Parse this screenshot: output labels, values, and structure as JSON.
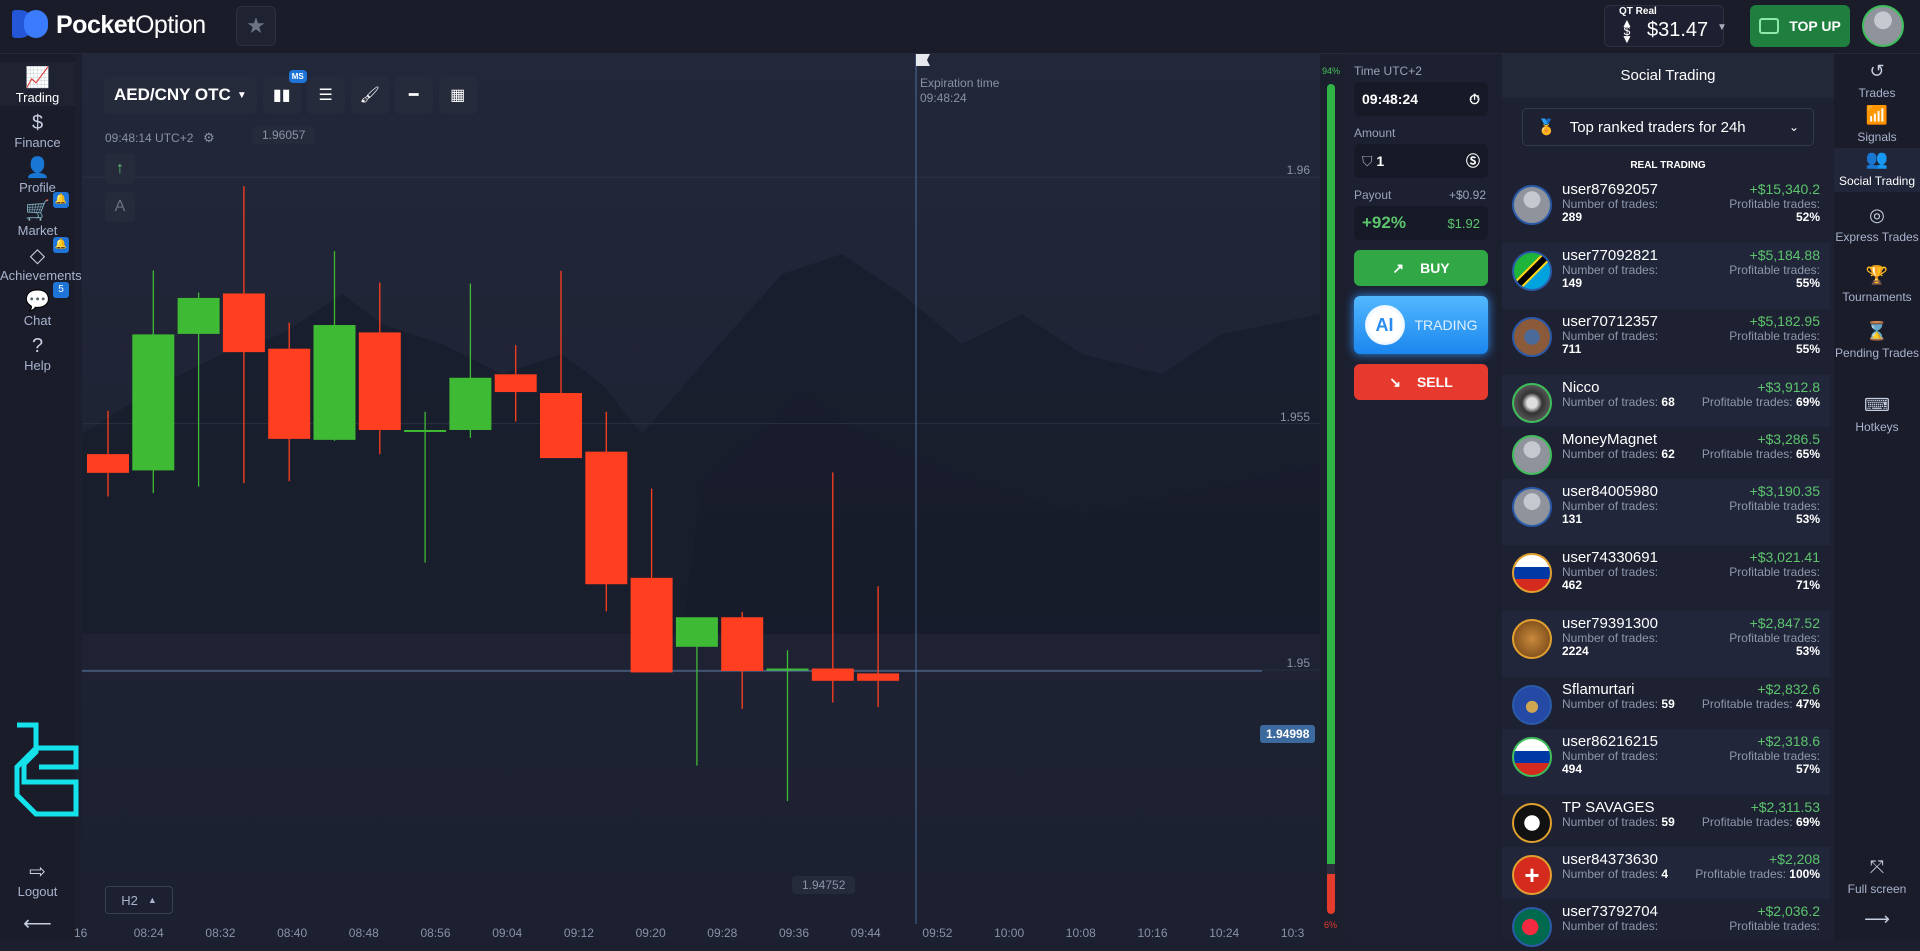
{
  "brand": {
    "name_bold": "Pocket",
    "name_light": "Option"
  },
  "header": {
    "account_label": "QT Real",
    "balance": "$31.47",
    "topup_label": "TOP UP"
  },
  "left_nav": [
    {
      "label": "Trading",
      "icon": "chart-line-icon",
      "glyph": "📈",
      "active": true
    },
    {
      "label": "Finance",
      "icon": "dollar-icon",
      "glyph": "$"
    },
    {
      "label": "Profile",
      "icon": "user-icon",
      "glyph": "👤"
    },
    {
      "label": "Market",
      "icon": "cart-icon",
      "glyph": "🛒",
      "badge": "🔔"
    },
    {
      "label": "Achievements",
      "icon": "diamond-icon",
      "glyph": "◇",
      "badge": "🔔"
    },
    {
      "label": "Chat",
      "icon": "chat-icon",
      "glyph": "💬",
      "badge": "5"
    },
    {
      "label": "Help",
      "icon": "help-icon",
      "glyph": "?"
    }
  ],
  "left_nav_bottom": {
    "logout_label": "Logout"
  },
  "chart_toolbar": {
    "pair": "AED/CNY OTC",
    "indicator_badge": "MS"
  },
  "chart_info": {
    "server_time": "09:48:14 UTC+2",
    "high_label": "1.96057",
    "low_label": "1.94752",
    "current_price": "1.94998",
    "expiration_label": "Expiration time",
    "expiration_time": "09:48:24",
    "timeframe": "H2",
    "side_tool_a": "A"
  },
  "chart_data": {
    "type": "candlestick",
    "title": "AED/CNY OTC",
    "y_ticks": [
      "1.96",
      "1.955",
      "1.95"
    ],
    "ylim": [
      1.9445,
      1.9625
    ],
    "x_ticks": [
      "16",
      "08:24",
      "08:32",
      "08:40",
      "08:48",
      "08:56",
      "09:04",
      "09:12",
      "09:20",
      "09:28",
      "09:36",
      "09:44",
      "09:52",
      "10:00",
      "10:08",
      "10:16",
      "10:24",
      "10:3"
    ],
    "candles": [
      {
        "o": 1.95438,
        "h": 1.95526,
        "l": 1.95352,
        "c": 1.954
      },
      {
        "o": 1.95405,
        "h": 1.95811,
        "l": 1.95359,
        "c": 1.95681
      },
      {
        "o": 1.95682,
        "h": 1.95766,
        "l": 1.95372,
        "c": 1.95755
      },
      {
        "o": 1.95764,
        "h": 1.95982,
        "l": 1.95379,
        "c": 1.95645
      },
      {
        "o": 1.95652,
        "h": 1.95705,
        "l": 1.95383,
        "c": 1.95469
      },
      {
        "o": 1.95467,
        "h": 1.9585,
        "l": 1.95465,
        "c": 1.957
      },
      {
        "o": 1.95685,
        "h": 1.95786,
        "l": 1.95438,
        "c": 1.95487
      },
      {
        "o": 1.95487,
        "h": 1.95524,
        "l": 1.95218,
        "c": 1.95487
      },
      {
        "o": 1.95487,
        "h": 1.95784,
        "l": 1.95471,
        "c": 1.95593
      },
      {
        "o": 1.956,
        "h": 1.95659,
        "l": 1.95504,
        "c": 1.95564
      },
      {
        "o": 1.95562,
        "h": 1.9581,
        "l": 1.95478,
        "c": 1.9543
      },
      {
        "o": 1.95443,
        "h": 1.95524,
        "l": 1.95119,
        "c": 1.95174
      },
      {
        "o": 1.95187,
        "h": 1.95368,
        "l": 1.94998,
        "c": 1.94995
      },
      {
        "o": 1.95047,
        "h": 1.95058,
        "l": 1.94806,
        "c": 1.95107
      },
      {
        "o": 1.95107,
        "h": 1.95118,
        "l": 1.94921,
        "c": 1.94998
      },
      {
        "o": 1.95,
        "h": 1.9504,
        "l": 1.94734,
        "c": 1.95003
      },
      {
        "o": 1.95003,
        "h": 1.95401,
        "l": 1.94934,
        "c": 1.94978
      },
      {
        "o": 1.94993,
        "h": 1.9517,
        "l": 1.94925,
        "c": 1.94978
      }
    ]
  },
  "sentiment": {
    "up_percent": 94,
    "down_percent": 6,
    "up_label": "94%",
    "down_label": "6%"
  },
  "trade_panel": {
    "time_label": "Time UTC+2",
    "time_value": "09:48:24",
    "amount_label": "Amount",
    "amount_value": "1",
    "payout_label": "Payout",
    "payout_profit": "+$0.92",
    "payout_percent": "+92%",
    "payout_total": "$1.92",
    "buy_label": "BUY",
    "ai_badge": "AI",
    "ai_label": "TRADING",
    "sell_label": "SELL"
  },
  "social": {
    "title": "Social Trading",
    "filter": "Top ranked traders for 24h",
    "section": "REAL TRADING",
    "trades_label": "Number of trades:",
    "profitable_label": "Profitable trades:",
    "traders": [
      {
        "name": "user87692057",
        "profit": "+$15,340.2",
        "trades": "289",
        "profitable": "52%",
        "avatar": "default",
        "ring": "#2b5aa8"
      },
      {
        "name": "user77092821",
        "profit": "+$5,184.88",
        "trades": "149",
        "profitable": "55%",
        "avatar": "tanzania",
        "ring": "#2b5aa8"
      },
      {
        "name": "user70712357",
        "profit": "+$5,182.95",
        "trades": "711",
        "profitable": "55%",
        "avatar": "car",
        "ring": "#2b5aa8"
      },
      {
        "name": "Nicco",
        "profit": "+$3,912.8",
        "trades": "68",
        "profitable": "69%",
        "avatar": "photo",
        "ring": "#3fbf5a"
      },
      {
        "name": "MoneyMagnet",
        "profit": "+$3,286.5",
        "trades": "62",
        "profitable": "65%",
        "avatar": "default",
        "ring": "#3fbf5a"
      },
      {
        "name": "user84005980",
        "profit": "+$3,190.35",
        "trades": "131",
        "profitable": "53%",
        "avatar": "default",
        "ring": "#2b5aa8"
      },
      {
        "name": "user74330691",
        "profit": "+$3,021.41",
        "trades": "462",
        "profitable": "71%",
        "avatar": "russia",
        "ring": "#e0a030"
      },
      {
        "name": "user79391300",
        "profit": "+$2,847.52",
        "trades": "2224",
        "profitable": "53%",
        "avatar": "coin",
        "ring": "#e0a030"
      },
      {
        "name": "Sflamurtari",
        "profit": "+$2,832.6",
        "trades": "59",
        "profitable": "47%",
        "avatar": "kosovo",
        "ring": "#2b5aa8"
      },
      {
        "name": "user86216215",
        "profit": "+$2,318.6",
        "trades": "494",
        "profitable": "57%",
        "avatar": "russia",
        "ring": "#3fbf5a"
      },
      {
        "name": "TP SAVAGES",
        "profit": "+$2,311.53",
        "trades": "59",
        "profitable": "69%",
        "avatar": "tp",
        "ring": "#e0a030"
      },
      {
        "name": "user84373630",
        "profit": "+$2,208",
        "trades": "4",
        "profitable": "100%",
        "avatar": "swiss",
        "ring": "#e0a030"
      },
      {
        "name": "user73792704",
        "profit": "+$2,036.2",
        "trades": "",
        "profitable": "",
        "avatar": "bangladesh",
        "ring": "#2b5aa8"
      }
    ]
  },
  "right_nav": [
    {
      "label": "Trades",
      "icon": "history-icon",
      "glyph": "↺"
    },
    {
      "label": "Signals",
      "icon": "signal-icon",
      "glyph": "📶"
    },
    {
      "label": "Social Trading",
      "icon": "users-icon",
      "glyph": "👥",
      "active": true
    },
    {
      "label": "Express Trades",
      "icon": "target-icon",
      "glyph": "◎"
    },
    {
      "label": "Tournaments",
      "icon": "trophy-icon",
      "glyph": "🏆"
    },
    {
      "label": "Pending Trades",
      "icon": "hourglass-icon",
      "glyph": "⌛"
    },
    {
      "label": "Hotkeys",
      "icon": "keyboard-icon",
      "glyph": "⌨"
    }
  ],
  "right_nav_bottom": {
    "fullscreen_label": "Full screen"
  },
  "colors": {
    "up": "#3fba34",
    "down": "#ff3f1f",
    "accent": "#1f74d8"
  }
}
